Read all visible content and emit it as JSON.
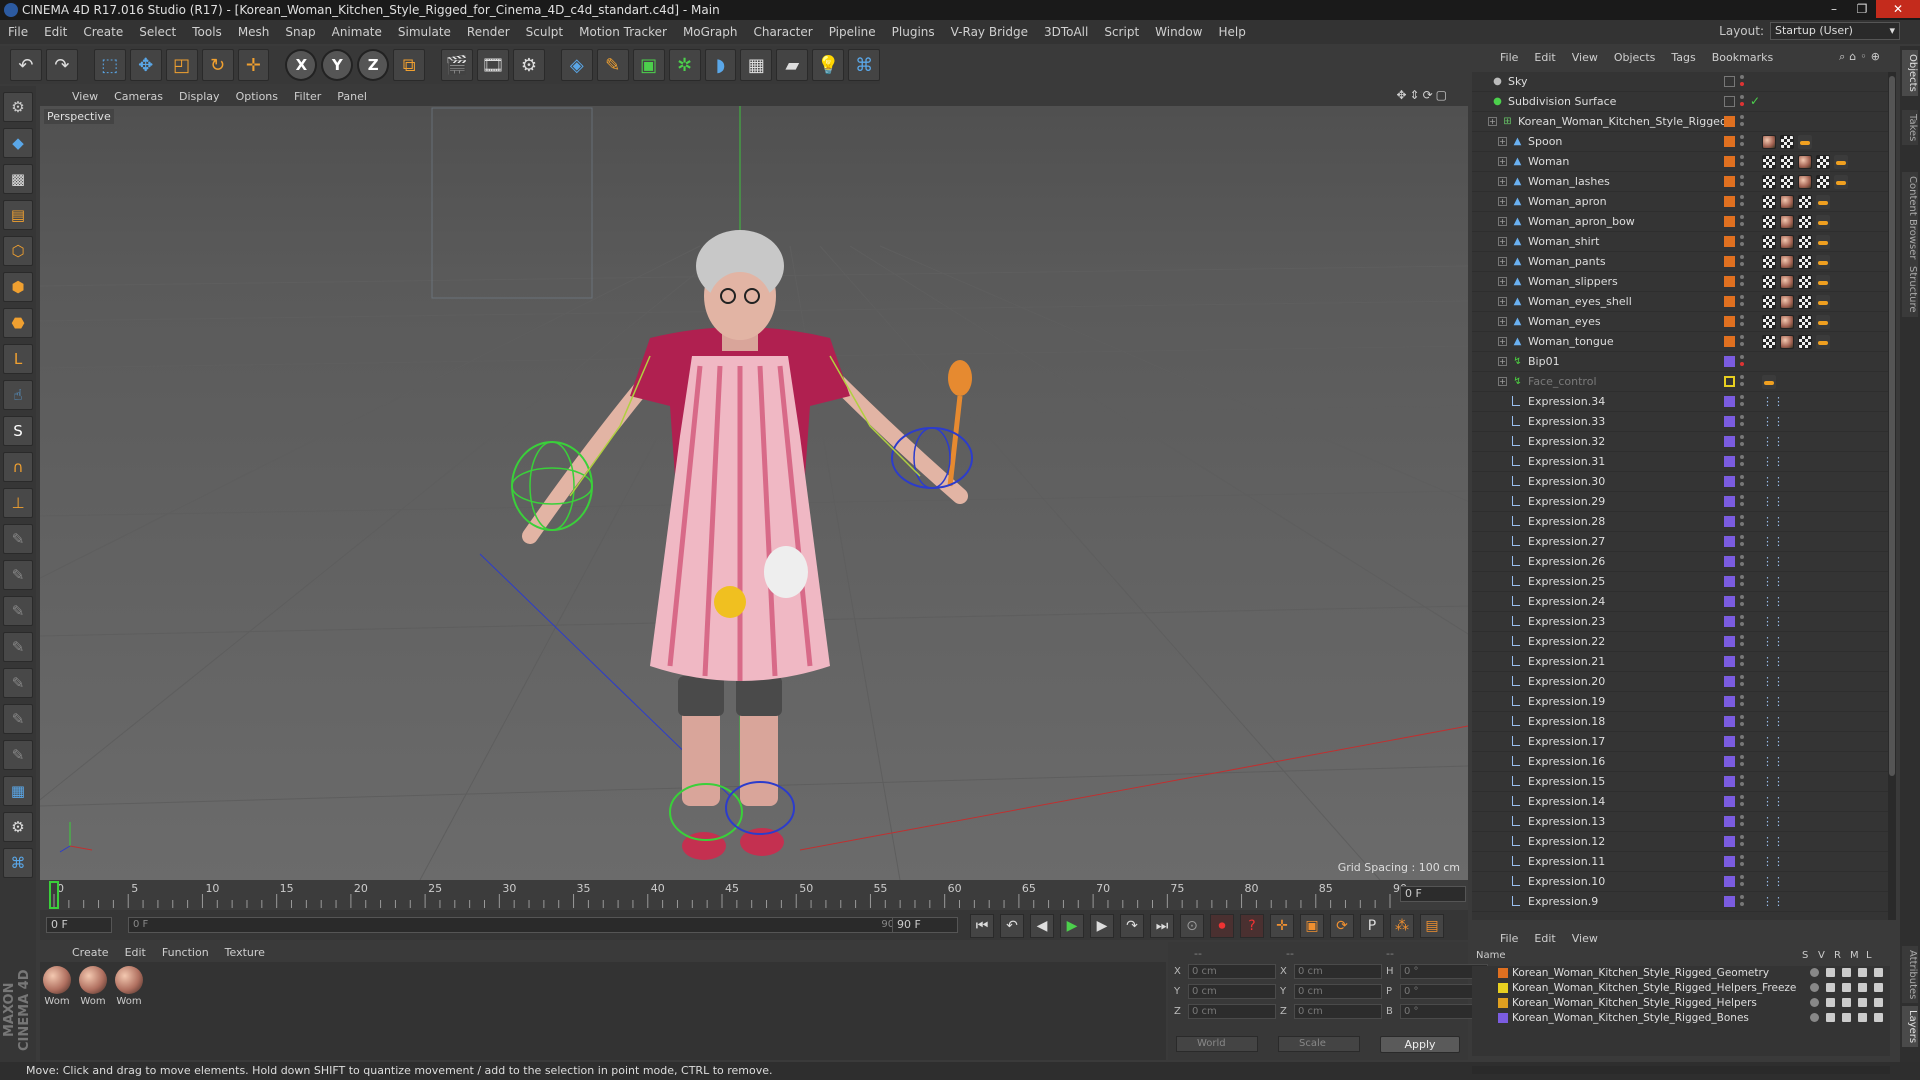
{
  "window": {
    "title": "CINEMA 4D R17.016 Studio (R17) - [Korean_Woman_Kitchen_Style_Rigged_for_Cinema_4D_c4d_standart.c4d] - Main"
  },
  "menu": [
    "File",
    "Edit",
    "Create",
    "Select",
    "Tools",
    "Mesh",
    "Snap",
    "Animate",
    "Simulate",
    "Render",
    "Sculpt",
    "Motion Tracker",
    "MoGraph",
    "Character",
    "Pipeline",
    "Plugins",
    "V-Ray Bridge",
    "3DToAll",
    "Script",
    "Window",
    "Help"
  ],
  "layout": {
    "label": "Layout:",
    "value": "Startup (User)"
  },
  "toolbar": {
    "axis_x": "X",
    "axis_y": "Y",
    "axis_z": "Z"
  },
  "viewport": {
    "menu": [
      "View",
      "Cameras",
      "Display",
      "Options",
      "Filter",
      "Panel"
    ],
    "label": "Perspective",
    "grid_spacing": "Grid Spacing : 100 cm"
  },
  "timeline": {
    "ticks": [
      "0",
      "5",
      "10",
      "15",
      "20",
      "25",
      "30",
      "35",
      "40",
      "45",
      "50",
      "55",
      "60",
      "65",
      "70",
      "75",
      "80",
      "85",
      "90"
    ],
    "current_frame": "0 F",
    "start_frame": "0 F",
    "range_start": "0 F",
    "range_end": "90 F",
    "end_frame": "90 F"
  },
  "materials": {
    "menu": [
      "Create",
      "Edit",
      "Function",
      "Texture"
    ],
    "items": [
      {
        "name": "Wom"
      },
      {
        "name": "Wom"
      },
      {
        "name": "Wom"
      }
    ]
  },
  "coords": {
    "header": [
      "--",
      "--",
      "--"
    ],
    "rows": [
      {
        "l1": "X",
        "v1": "0 cm",
        "l2": "X",
        "v2": "0 cm",
        "l3": "H",
        "v3": "0 °"
      },
      {
        "l1": "Y",
        "v1": "0 cm",
        "l2": "Y",
        "v2": "0 cm",
        "l3": "P",
        "v3": "0 °"
      },
      {
        "l1": "Z",
        "v1": "0 cm",
        "l2": "Z",
        "v2": "0 cm",
        "l3": "B",
        "v3": "0 °"
      }
    ],
    "space": "World",
    "mode": "Scale",
    "apply": "Apply"
  },
  "status": "Move: Click and drag to move elements. Hold down SHIFT to quantize movement / add to the selection in point mode, CTRL to remove.",
  "objects": {
    "menu": [
      "File",
      "Edit",
      "View",
      "Objects",
      "Tags",
      "Bookmarks"
    ],
    "items": [
      {
        "name": "Sky",
        "indent": 0,
        "icon": "sky",
        "layer": "",
        "tags": []
      },
      {
        "name": "Subdivision Surface",
        "indent": 0,
        "icon": "subdiv",
        "layer": "",
        "tags": [],
        "check": true
      },
      {
        "name": "Korean_Woman_Kitchen_Style_Rigged",
        "indent": 1,
        "icon": "null",
        "layer": "#e07020",
        "tags": []
      },
      {
        "name": "Spoon",
        "indent": 2,
        "icon": "bone",
        "layer": "#e07020",
        "tags": [
          "mat",
          "uv",
          "phong"
        ]
      },
      {
        "name": "Woman",
        "indent": 2,
        "icon": "bone",
        "layer": "#e07020",
        "tags": [
          "uv",
          "w",
          "mat",
          "uv",
          "phong"
        ]
      },
      {
        "name": "Woman_lashes",
        "indent": 2,
        "icon": "bone",
        "layer": "#e07020",
        "tags": [
          "uv",
          "w",
          "mat",
          "uv",
          "phong"
        ]
      },
      {
        "name": "Woman_apron",
        "indent": 2,
        "icon": "bone",
        "layer": "#e07020",
        "tags": [
          "uv",
          "mat",
          "uv",
          "phong"
        ]
      },
      {
        "name": "Woman_apron_bow",
        "indent": 2,
        "icon": "bone",
        "layer": "#e07020",
        "tags": [
          "uv",
          "mat",
          "uv",
          "phong"
        ]
      },
      {
        "name": "Woman_shirt",
        "indent": 2,
        "icon": "bone",
        "layer": "#e07020",
        "tags": [
          "uv",
          "mat",
          "uv",
          "phong"
        ]
      },
      {
        "name": "Woman_pants",
        "indent": 2,
        "icon": "bone",
        "layer": "#e07020",
        "tags": [
          "uv",
          "mat",
          "uv",
          "phong"
        ]
      },
      {
        "name": "Woman_slippers",
        "indent": 2,
        "icon": "bone",
        "layer": "#e07020",
        "tags": [
          "uv",
          "mat",
          "uv",
          "phong"
        ]
      },
      {
        "name": "Woman_eyes_shell",
        "indent": 2,
        "icon": "bone",
        "layer": "#e07020",
        "tags": [
          "uv",
          "mat",
          "uv",
          "phong"
        ]
      },
      {
        "name": "Woman_eyes",
        "indent": 2,
        "icon": "bone",
        "layer": "#e07020",
        "tags": [
          "uv",
          "mat",
          "uv",
          "phong"
        ]
      },
      {
        "name": "Woman_tongue",
        "indent": 2,
        "icon": "bone",
        "layer": "#e07020",
        "tags": [
          "uv",
          "mat",
          "uv",
          "phong"
        ]
      },
      {
        "name": "Bip01",
        "indent": 2,
        "icon": "joint",
        "layer": "#7b5ce0",
        "tags": [],
        "redDot": true
      },
      {
        "name": "Face_control",
        "indent": 2,
        "icon": "joint",
        "layer": "#e8d020",
        "tags": [
          "n"
        ],
        "dim": true
      },
      {
        "name": "Expression.34",
        "indent": 2,
        "icon": "expr",
        "layer": "#7b5ce0",
        "tags": [
          "xp"
        ]
      },
      {
        "name": "Expression.33",
        "indent": 2,
        "icon": "expr",
        "layer": "#7b5ce0",
        "tags": [
          "xp"
        ]
      },
      {
        "name": "Expression.32",
        "indent": 2,
        "icon": "expr",
        "layer": "#7b5ce0",
        "tags": [
          "xp"
        ]
      },
      {
        "name": "Expression.31",
        "indent": 2,
        "icon": "expr",
        "layer": "#7b5ce0",
        "tags": [
          "xp"
        ]
      },
      {
        "name": "Expression.30",
        "indent": 2,
        "icon": "expr",
        "layer": "#7b5ce0",
        "tags": [
          "xp"
        ]
      },
      {
        "name": "Expression.29",
        "indent": 2,
        "icon": "expr",
        "layer": "#7b5ce0",
        "tags": [
          "xp"
        ]
      },
      {
        "name": "Expression.28",
        "indent": 2,
        "icon": "expr",
        "layer": "#7b5ce0",
        "tags": [
          "xp"
        ]
      },
      {
        "name": "Expression.27",
        "indent": 2,
        "icon": "expr",
        "layer": "#7b5ce0",
        "tags": [
          "xp"
        ]
      },
      {
        "name": "Expression.26",
        "indent": 2,
        "icon": "expr",
        "layer": "#7b5ce0",
        "tags": [
          "xp"
        ]
      },
      {
        "name": "Expression.25",
        "indent": 2,
        "icon": "expr",
        "layer": "#7b5ce0",
        "tags": [
          "xp"
        ]
      },
      {
        "name": "Expression.24",
        "indent": 2,
        "icon": "expr",
        "layer": "#7b5ce0",
        "tags": [
          "xp"
        ]
      },
      {
        "name": "Expression.23",
        "indent": 2,
        "icon": "expr",
        "layer": "#7b5ce0",
        "tags": [
          "xp"
        ]
      },
      {
        "name": "Expression.22",
        "indent": 2,
        "icon": "expr",
        "layer": "#7b5ce0",
        "tags": [
          "xp"
        ]
      },
      {
        "name": "Expression.21",
        "indent": 2,
        "icon": "expr",
        "layer": "#7b5ce0",
        "tags": [
          "xp"
        ]
      },
      {
        "name": "Expression.20",
        "indent": 2,
        "icon": "expr",
        "layer": "#7b5ce0",
        "tags": [
          "xp"
        ]
      },
      {
        "name": "Expression.19",
        "indent": 2,
        "icon": "expr",
        "layer": "#7b5ce0",
        "tags": [
          "xp"
        ]
      },
      {
        "name": "Expression.18",
        "indent": 2,
        "icon": "expr",
        "layer": "#7b5ce0",
        "tags": [
          "xp"
        ]
      },
      {
        "name": "Expression.17",
        "indent": 2,
        "icon": "expr",
        "layer": "#7b5ce0",
        "tags": [
          "xp"
        ]
      },
      {
        "name": "Expression.16",
        "indent": 2,
        "icon": "expr",
        "layer": "#7b5ce0",
        "tags": [
          "xp"
        ]
      },
      {
        "name": "Expression.15",
        "indent": 2,
        "icon": "expr",
        "layer": "#7b5ce0",
        "tags": [
          "xp"
        ]
      },
      {
        "name": "Expression.14",
        "indent": 2,
        "icon": "expr",
        "layer": "#7b5ce0",
        "tags": [
          "xp"
        ]
      },
      {
        "name": "Expression.13",
        "indent": 2,
        "icon": "expr",
        "layer": "#7b5ce0",
        "tags": [
          "xp"
        ]
      },
      {
        "name": "Expression.12",
        "indent": 2,
        "icon": "expr",
        "layer": "#7b5ce0",
        "tags": [
          "xp"
        ]
      },
      {
        "name": "Expression.11",
        "indent": 2,
        "icon": "expr",
        "layer": "#7b5ce0",
        "tags": [
          "xp"
        ]
      },
      {
        "name": "Expression.10",
        "indent": 2,
        "icon": "expr",
        "layer": "#7b5ce0",
        "tags": [
          "xp"
        ]
      },
      {
        "name": "Expression.9",
        "indent": 2,
        "icon": "expr",
        "layer": "#7b5ce0",
        "tags": [
          "xp"
        ]
      }
    ]
  },
  "layers": {
    "menu": [
      "File",
      "Edit",
      "View"
    ],
    "headers": {
      "name": "Name",
      "s": "S",
      "v": "V",
      "r": "R",
      "m": "M",
      "l": "L"
    },
    "items": [
      {
        "name": "Korean_Woman_Kitchen_Style_Rigged_Geometry",
        "color": "#e07020"
      },
      {
        "name": "Korean_Woman_Kitchen_Style_Rigged_Helpers_Freeze",
        "color": "#e8d020"
      },
      {
        "name": "Korean_Woman_Kitchen_Style_Rigged_Helpers",
        "color": "#e0a020"
      },
      {
        "name": "Korean_Woman_Kitchen_Style_Rigged_Bones",
        "color": "#7b5ce0"
      }
    ]
  },
  "sidetabs": [
    "Objects",
    "Takes",
    "Content Browser",
    "Structure",
    "Attributes",
    "Layers"
  ]
}
